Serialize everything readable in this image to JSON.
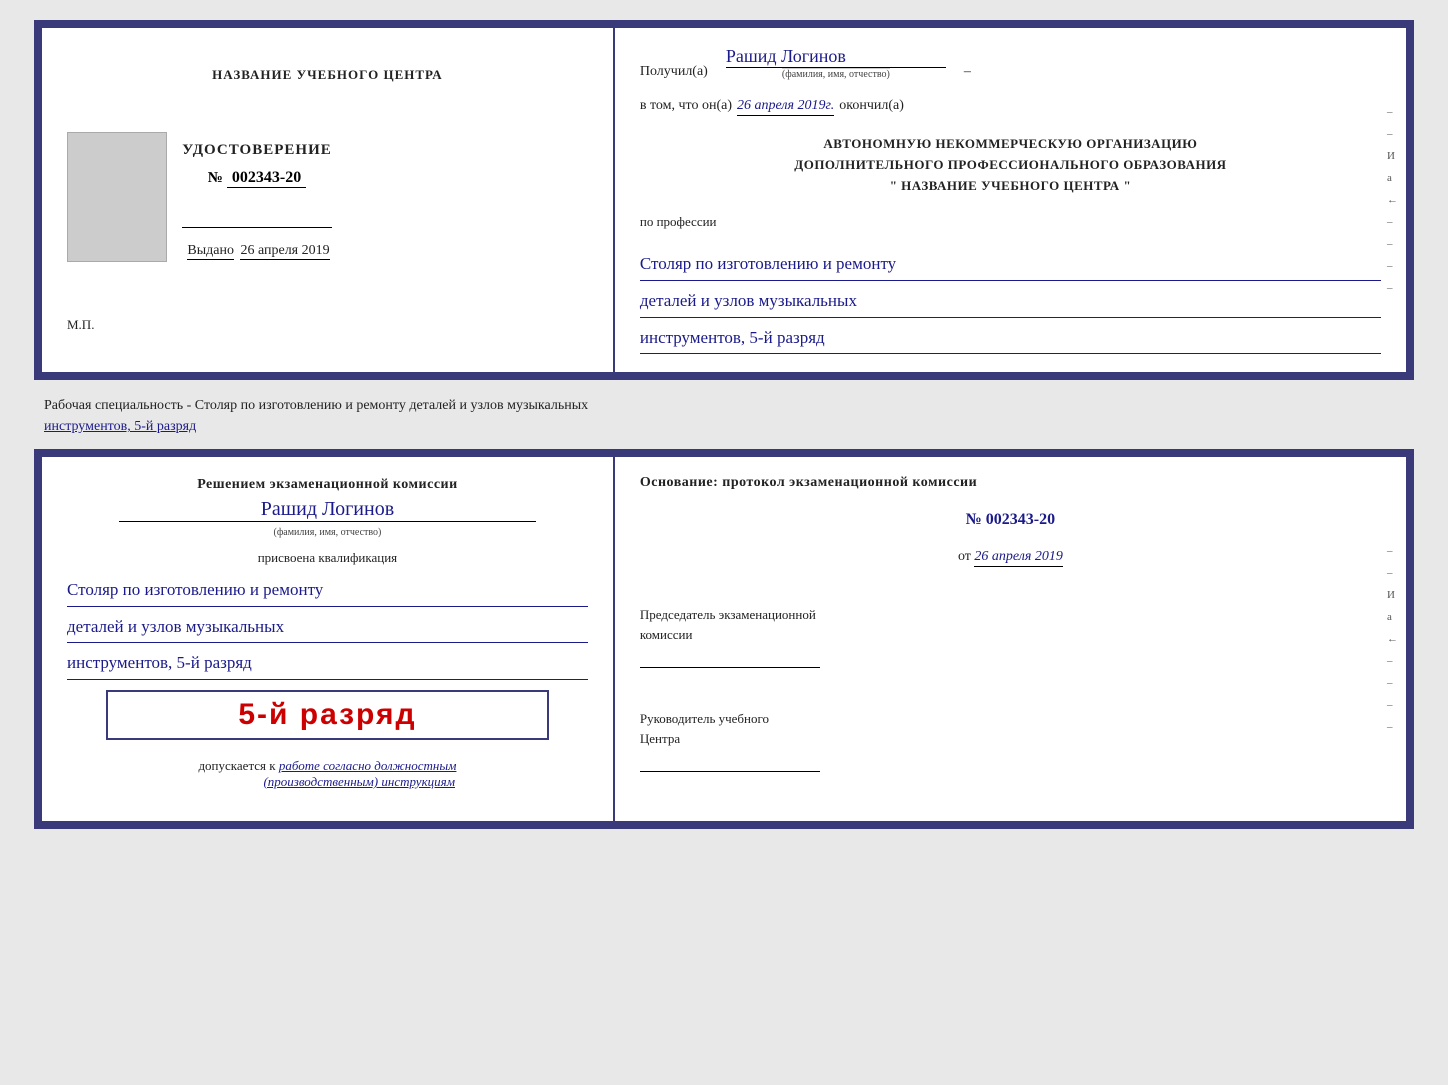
{
  "top_cert": {
    "left": {
      "center_title": "НАЗВАНИЕ УЧЕБНОГО ЦЕНТРА",
      "udostoverenie_label": "УДОСТОВЕРЕНИЕ",
      "number_prefix": "№",
      "number": "002343-20",
      "vydano_label": "Выдано",
      "vydano_date": "26 апреля 2019",
      "mp_label": "М.П."
    },
    "right": {
      "poluchil_label": "Получил(а)",
      "name_val": "Рашид Логинов",
      "fio_hint": "(фамилия, имя, отчество)",
      "dash": "–",
      "vtom_label": "в том, что он(а)",
      "vtom_date": "26 апреля 2019г.",
      "okanchil_label": "окончил(а)",
      "org_line1": "АВТОНОМНУЮ НЕКОММЕРЧЕСКУЮ ОРГАНИЗАЦИЮ",
      "org_line2": "ДОПОЛНИТЕЛЬНОГО ПРОФЕССИОНАЛЬНОГО ОБРАЗОВАНИЯ",
      "org_line3": "\"  НАЗВАНИЕ УЧЕБНОГО ЦЕНТРА  \"",
      "po_professii": "по профессии",
      "profession_line1": "Столяр по изготовлению и ремонту",
      "profession_line2": "деталей и узлов музыкальных",
      "profession_line3": "инструментов, 5-й разряд"
    }
  },
  "specialty_text": "Рабочая специальность - Столяр по изготовлению и ремонту деталей и узлов музыкальных",
  "specialty_text2": "инструментов, 5-й разряд",
  "bottom_cert": {
    "left": {
      "resheniem_label": "Решением экзаменационной комиссии",
      "name_val": "Рашид Логинов",
      "fio_hint": "(фамилия, имя, отчество)",
      "prisvoena_label": "присвоена квалификация",
      "qualification_line1": "Столяр по изготовлению и ремонту",
      "qualification_line2": "деталей и узлов музыкальных",
      "qualification_line3": "инструментов, 5-й разряд",
      "razryad_big": "5-й разряд",
      "dopuskaetsya_label": "допускается к",
      "dopuskaetsya_val": "работе согласно должностным",
      "dopuskaetsya_val2": "(производственным) инструкциям"
    },
    "right": {
      "osnovanie_label": "Основание: протокол экзаменационной комиссии",
      "number_prefix": "№",
      "number": "002343-20",
      "ot_label": "от",
      "ot_date": "26 апреля 2019",
      "predsedatel_label": "Председатель экзаменационной",
      "komissii_label": "комиссии",
      "rukovoditel_label": "Руководитель учебного",
      "centra_label": "Центра"
    }
  },
  "side_marks": {
    "mark1": "И",
    "mark2": "а",
    "mark3": "←",
    "mark4": "–",
    "mark5": "–",
    "mark6": "–",
    "mark7": "–"
  }
}
